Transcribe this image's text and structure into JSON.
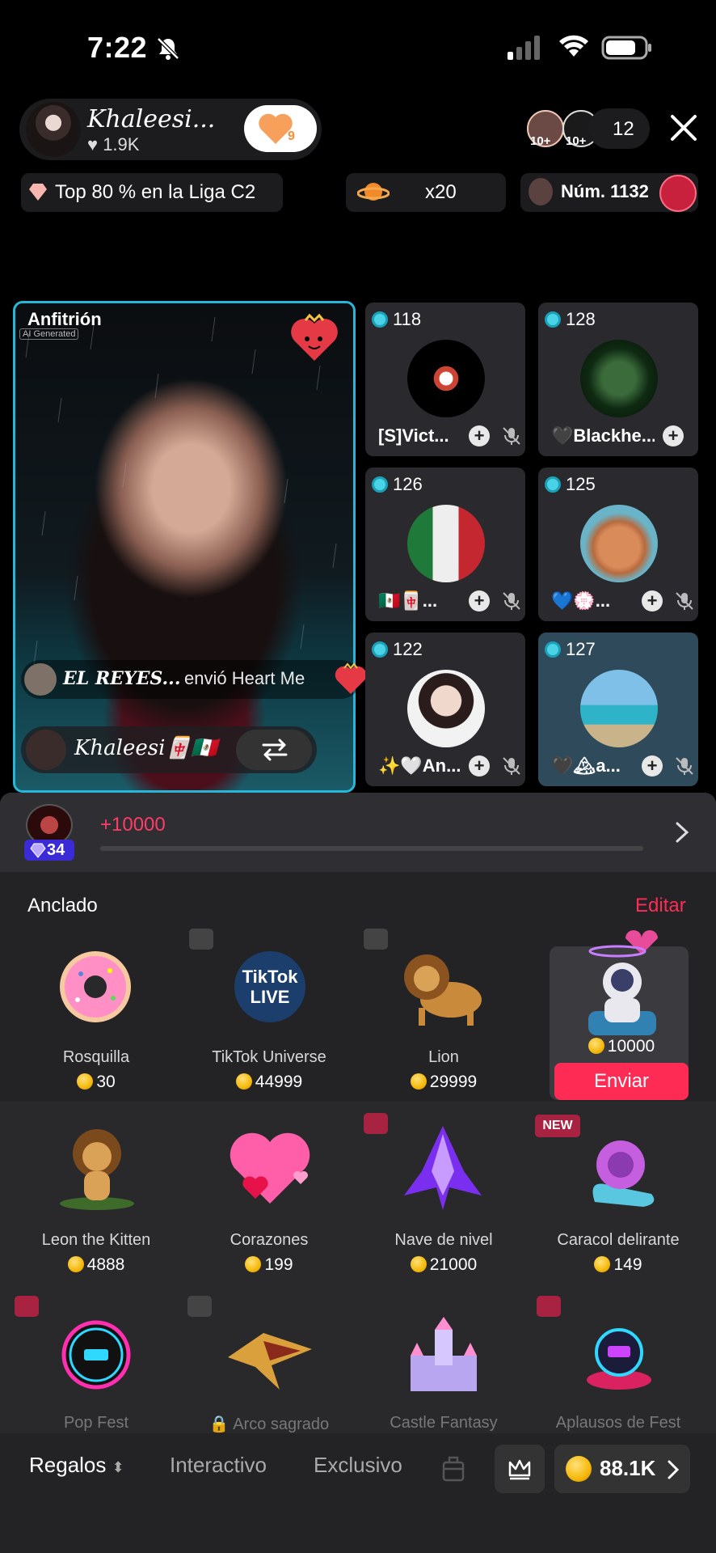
{
  "status": {
    "time": "7:22"
  },
  "header": {
    "host_name": "Khaleesi...",
    "host_likes": "1.9K",
    "follow_count": "9",
    "viewer_badge_1": "10+",
    "viewer_badge_2": "10+",
    "viewer_count": "12",
    "league": "Top 80 % en la Liga C2",
    "combo": "x20",
    "rank": "Núm. 1132"
  },
  "host_tile": {
    "label": "Anfitrión",
    "ai_tag": "AI Generated",
    "gift_user": "EL REYES...",
    "gift_text": "envió Heart Me",
    "host_name": "Khaleesi🀄🇲🇽"
  },
  "guests": [
    {
      "score": "118",
      "name": "[S]Vict..."
    },
    {
      "score": "128",
      "name": "🖤Blackhe..."
    },
    {
      "score": "126",
      "name": "🇲🇽🀄..."
    },
    {
      "score": "125",
      "name": "💙💮..."
    },
    {
      "score": "122",
      "name": "✨🤍An..."
    },
    {
      "score": "127",
      "name": "🖤🏔a..."
    }
  ],
  "progress": {
    "level": "34",
    "text": "+10000",
    "percent": 0
  },
  "pinned": {
    "title": "Anclado",
    "edit": "Editar",
    "send": "Enviar",
    "selected_price": "10000"
  },
  "gifts": [
    {
      "name": "Rosquilla",
      "price": "30"
    },
    {
      "name": "TikTok Universe",
      "price": "44999"
    },
    {
      "name": "Lion",
      "price": "29999"
    },
    {
      "name": "Leon the Kitten",
      "price": "4888"
    },
    {
      "name": "Corazones",
      "price": "199"
    },
    {
      "name": "Nave de nivel",
      "price": "21000"
    },
    {
      "name": "Caracol delirante",
      "price": "149"
    },
    {
      "name": "Pop Fest"
    },
    {
      "name": "Arco sagrado"
    },
    {
      "name": "Castle Fantasy"
    },
    {
      "name": "Aplausos de Fest"
    }
  ],
  "new_tag": "NEW",
  "tabs": {
    "regalos": "Regalos",
    "interactivo": "Interactivo",
    "exclusivo": "Exclusivo"
  },
  "balance": "88.1K",
  "colors": {
    "accent": "#fe2c55",
    "host_border": "#27b5d8",
    "coin": "#f5b90a"
  }
}
